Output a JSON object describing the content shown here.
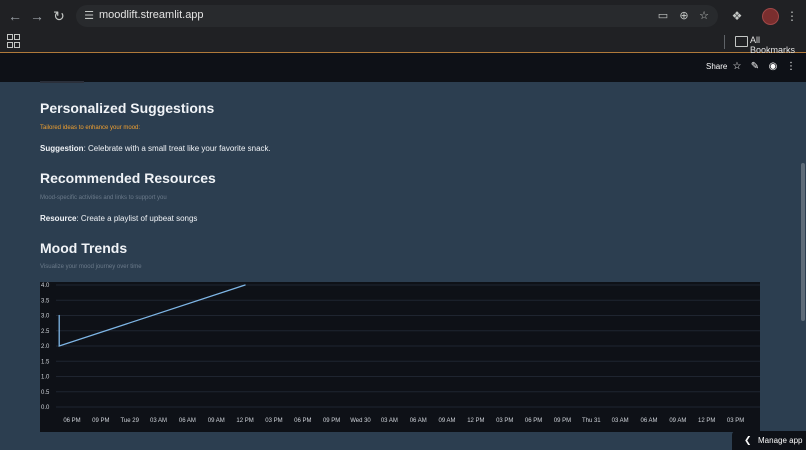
{
  "browser": {
    "url": "moodlift.streamlit.app",
    "bookmarks_label": "All Bookmarks",
    "icons": {
      "back": "arrow-left",
      "forward": "arrow-right",
      "reload": "reload",
      "site_info": "tune",
      "install": "install-app",
      "zoom": "zoom",
      "star": "star",
      "extensions": "puzzle",
      "profile": "avatar",
      "menu": "kebab",
      "apps": "grid",
      "folder": "folder"
    }
  },
  "app_header": {
    "share_label": "Share",
    "icons": [
      "star",
      "pencil",
      "github",
      "kebab"
    ]
  },
  "sections": {
    "suggestions": {
      "title": "Personalized Suggestions",
      "caption": "Tailored ideas to enhance your mood:",
      "label": "Suggestion",
      "text": ": Celebrate with a small treat like your favorite snack."
    },
    "resources": {
      "title": "Recommended Resources",
      "caption": "Mood-specific activities and links to support you",
      "label": "Resource",
      "text": ": Create a playlist of upbeat songs"
    },
    "trends": {
      "title": "Mood Trends",
      "caption": "Visualize your mood journey over time"
    }
  },
  "chart_data": {
    "type": "line",
    "title": "",
    "xlabel": "",
    "ylabel": "",
    "x_ticks": [
      "06 PM",
      "09 PM",
      "Tue 29",
      "03 AM",
      "06 AM",
      "09 AM",
      "12 PM",
      "03 PM",
      "06 PM",
      "09 PM",
      "Wed 30",
      "03 AM",
      "06 AM",
      "09 AM",
      "12 PM",
      "03 PM",
      "06 PM",
      "09 PM",
      "Thu 31",
      "03 AM",
      "06 AM",
      "09 AM",
      "12 PM",
      "03 PM"
    ],
    "y_ticks": [
      "0.0",
      "0.5",
      "1.0",
      "1.5",
      "2.0",
      "2.5",
      "3.0",
      "3.5",
      "4.0"
    ],
    "ylim": [
      0,
      4
    ],
    "series": [
      {
        "color": "#7eb6e6",
        "points": [
          {
            "x": "Mon 28 4:40 PM",
            "y": 3.0
          },
          {
            "x": "Mon 28 4:40 PM",
            "y": 2.0
          },
          {
            "x": "Tue 29 12:00 PM",
            "y": 4.0
          }
        ]
      }
    ],
    "grid": true
  },
  "manage_app": {
    "label": "Manage app"
  },
  "colors": {
    "page_bg": "#2c3e50",
    "header_bg": "#0e1117",
    "chart_bg": "#0e1117",
    "line": "#7eb6e6",
    "caption_orange": "#f0a030"
  }
}
